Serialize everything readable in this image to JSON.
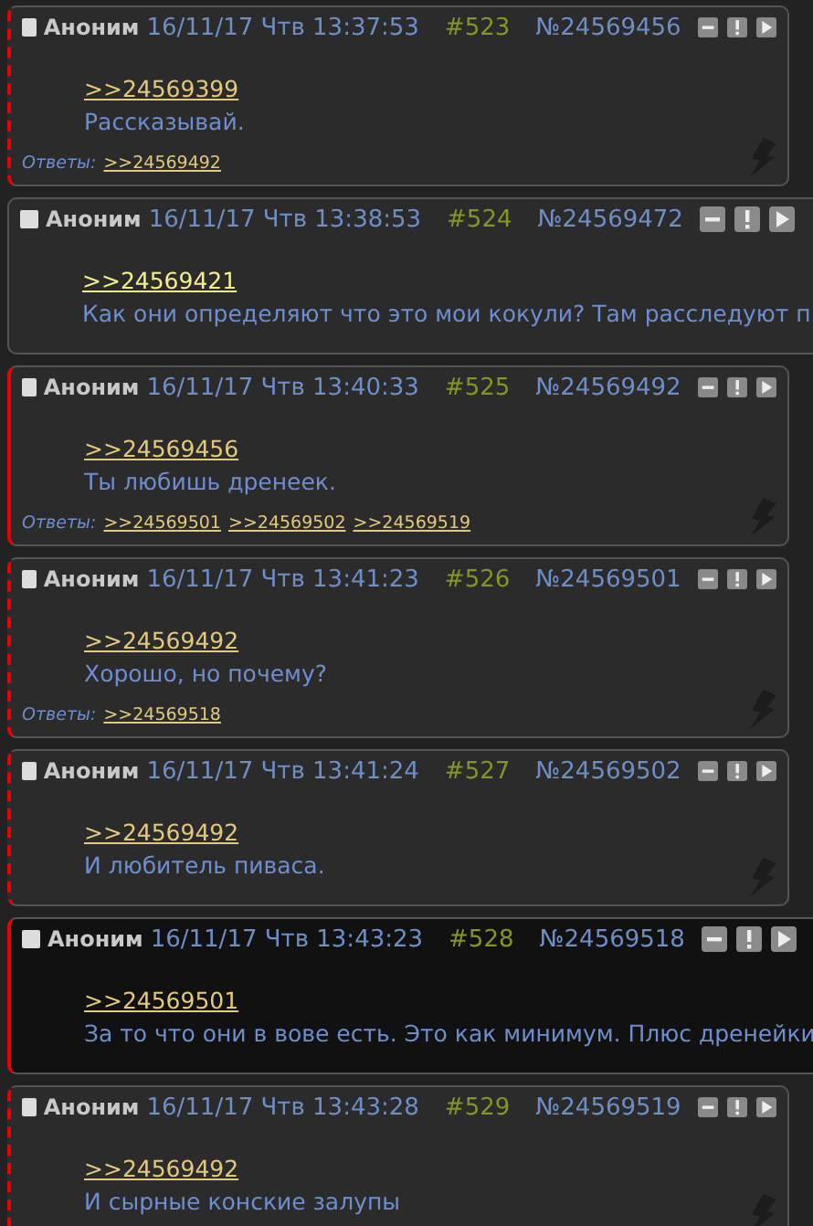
{
  "posts": [
    {
      "name": "Аноним",
      "date": "16/11/17 Чтв 13:37:53",
      "num": "#523",
      "id": "№24569456",
      "quote": ">>24569399",
      "quote_highlighted": false,
      "text": "Рассказывай.",
      "replies_label": "Ответы:",
      "replies": [
        ">>24569492"
      ],
      "kind": "dashed",
      "highlighted": false,
      "wide": false
    },
    {
      "name": "Аноним",
      "date": "16/11/17 Чтв 13:38:53",
      "num": "#524",
      "id": "№24569472",
      "quote": ">>24569421",
      "quote_highlighted": true,
      "text": "Как они определяют что это мои кокули? Там расследуют п",
      "kind": "plain",
      "highlighted": false,
      "wide": true
    },
    {
      "name": "Аноним",
      "date": "16/11/17 Чтв 13:40:33",
      "num": "#525",
      "id": "№24569492",
      "quote": ">>24569456",
      "quote_highlighted": false,
      "text": "Ты любишь дренеек.",
      "replies_label": "Ответы:",
      "replies": [
        ">>24569501",
        ">>24569502",
        ">>24569519"
      ],
      "kind": "solid",
      "highlighted": false,
      "wide": false
    },
    {
      "name": "Аноним",
      "date": "16/11/17 Чтв 13:41:23",
      "num": "#526",
      "id": "№24569501",
      "quote": ">>24569492",
      "quote_highlighted": false,
      "text": "Хорошо, но почему?",
      "replies_label": "Ответы:",
      "replies": [
        ">>24569518"
      ],
      "kind": "dashed",
      "highlighted": false,
      "wide": false
    },
    {
      "name": "Аноним",
      "date": "16/11/17 Чтв 13:41:24",
      "num": "#527",
      "id": "№24569502",
      "quote": ">>24569492",
      "quote_highlighted": false,
      "text": "И любитель пиваса.",
      "kind": "dashed",
      "highlighted": false,
      "wide": false
    },
    {
      "name": "Аноним",
      "date": "16/11/17 Чтв 13:43:23",
      "num": "#528",
      "id": "№24569518",
      "quote": ">>24569501",
      "quote_highlighted": false,
      "text": "За то что они в вове есть. Это как минимум. Плюс дренейки",
      "kind": "solid",
      "highlighted": true,
      "wide": true
    },
    {
      "name": "Аноним",
      "date": "16/11/17 Чтв 13:43:28",
      "num": "#529",
      "id": "№24569519",
      "quote": ">>24569492",
      "quote_highlighted": false,
      "text": "И сырные конские залупы",
      "kind": "dashed",
      "highlighted": false,
      "wide": false
    }
  ]
}
